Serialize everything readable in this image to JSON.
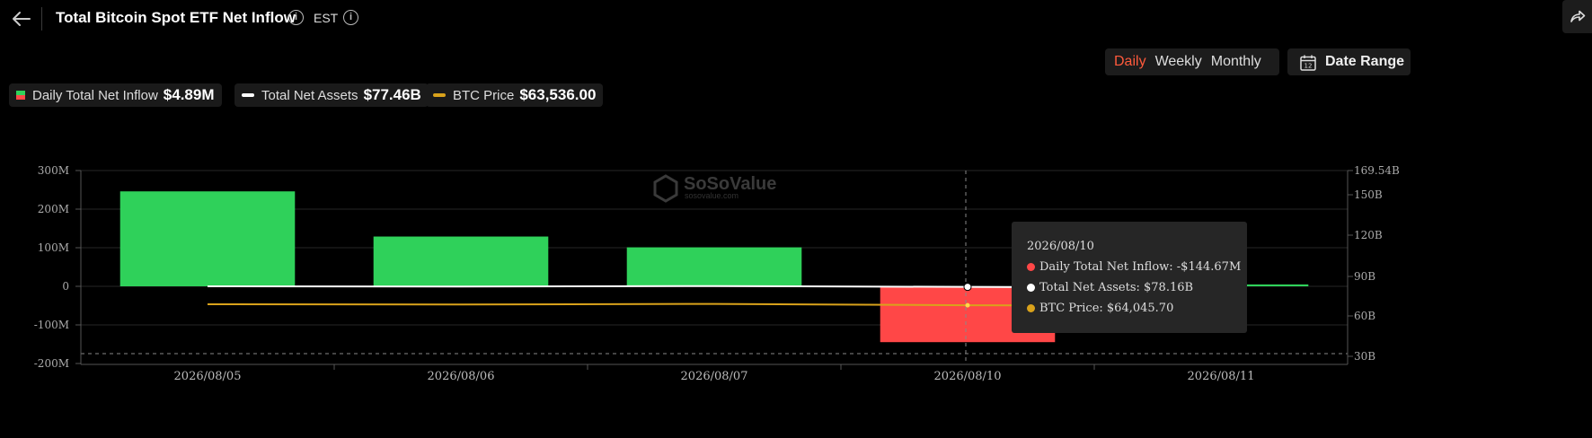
{
  "header": {
    "title": "Total Bitcoin Spot ETF Net Inflow",
    "timezone": "EST"
  },
  "period_tabs": [
    {
      "label": "Daily",
      "active": true
    },
    {
      "label": "Weekly",
      "active": false
    },
    {
      "label": "Monthly",
      "active": false
    }
  ],
  "date_range": {
    "label": "Date Range",
    "icon_text": "12"
  },
  "legend": [
    {
      "label": "Daily Total Net Inflow",
      "value": "$4.89M"
    },
    {
      "label": "Total Net Assets",
      "value": "$77.46B"
    },
    {
      "label": "BTC Price",
      "value": "$63,536.00"
    }
  ],
  "watermark": {
    "brand": "SoSoValue",
    "site": "sosovalue.com"
  },
  "tooltip": {
    "date": "2026/08/10",
    "rows": [
      {
        "text": "Daily Total Net Inflow: -$144.67M",
        "color": "#ff4747"
      },
      {
        "text": "Total Net Assets: $78.16B",
        "color": "#ffffff"
      },
      {
        "text": "BTC Price: $64,045.70",
        "color": "#d9a21b"
      }
    ]
  },
  "colors": {
    "positive": "#2fd15a",
    "negative": "#ff4747",
    "assets_line": "#ffffff",
    "price_line": "#d9a21b",
    "active_tab": "#ff5a3c"
  },
  "chart_data": {
    "type": "bar",
    "categories": [
      "2026/08/05",
      "2026/08/06",
      "2026/08/07",
      "2026/08/10",
      "2026/08/11"
    ],
    "series": [
      {
        "name": "Daily Total Net Inflow",
        "axis": "left",
        "type": "bar",
        "values": [
          246,
          129,
          101,
          -144.67,
          4.89
        ]
      },
      {
        "name": "Total Net Assets",
        "axis": "right",
        "type": "line",
        "values": [
          78.6,
          78.4,
          78.8,
          78.16,
          77.46
        ]
      },
      {
        "name": "BTC Price",
        "axis": "right",
        "type": "line",
        "values": [
          64.8,
          64.6,
          65.1,
          64.0457,
          63.536
        ]
      }
    ],
    "left_axis": {
      "ticks": [
        "300M",
        "200M",
        "100M",
        "0",
        "-100M",
        "-200M"
      ],
      "tick_values": [
        300,
        200,
        100,
        0,
        -100,
        -200
      ],
      "ylim": [
        -200,
        300
      ]
    },
    "right_axis": {
      "ticks": [
        "169.54B",
        "150B",
        "120B",
        "90B",
        "60B",
        "30B"
      ],
      "tick_values": [
        169.54,
        150,
        120,
        90,
        60,
        30
      ]
    },
    "grid": true,
    "legend_placement": "top-left"
  }
}
